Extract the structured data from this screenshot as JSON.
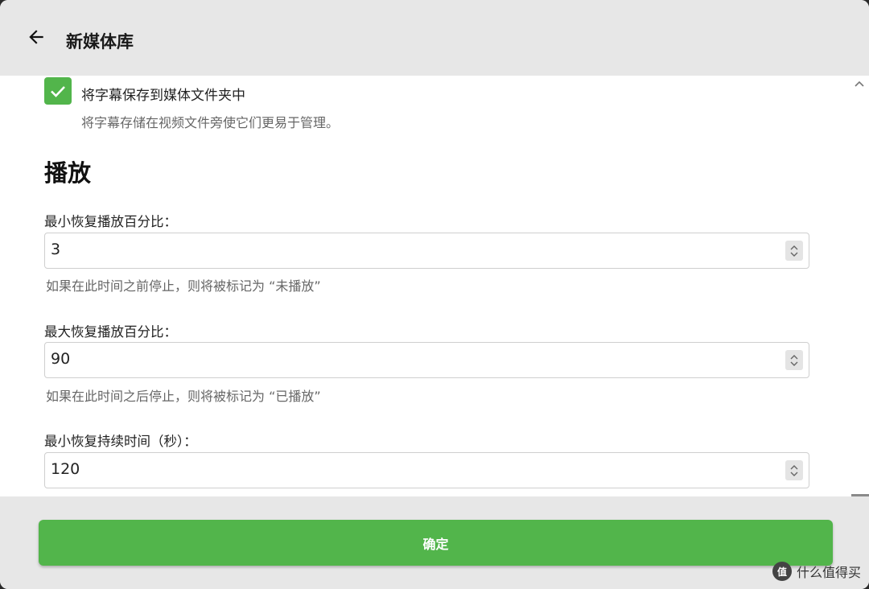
{
  "header": {
    "title": "新媒体库",
    "back_icon": "arrow-left-icon"
  },
  "subtitles": {
    "checkbox_checked": true,
    "label": "将字幕保存到媒体文件夹中",
    "description": "将字幕存储在视频文件旁使它们更易于管理。"
  },
  "playback": {
    "section_title": "播放",
    "fields": [
      {
        "label": "最小恢复播放百分比：",
        "value": "3",
        "help": "如果在此时间之前停止，则将被标记为 “未播放”"
      },
      {
        "label": "最大恢复播放百分比：",
        "value": "90",
        "help": "如果在此时间之后停止，则将被标记为 “已播放”"
      },
      {
        "label": "最小恢复持续时间（秒）：",
        "value": "120",
        "help": ""
      }
    ]
  },
  "footer": {
    "ok_label": "确定"
  },
  "watermark": {
    "logo_text": "值",
    "text": "什么值得买"
  },
  "colors": {
    "accent": "#52b54b",
    "header_bg": "#e7e7e7"
  }
}
